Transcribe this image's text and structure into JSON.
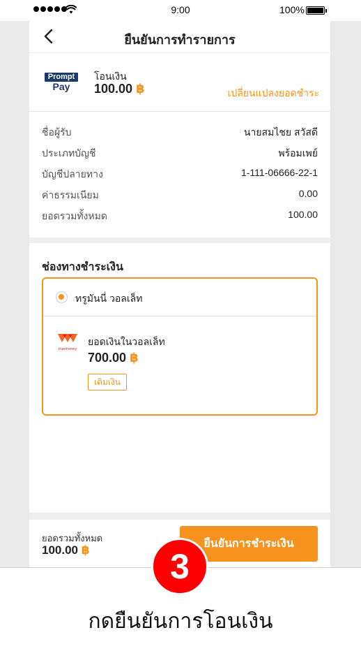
{
  "status_bar": {
    "time": "9:00",
    "battery": "100%"
  },
  "nav": {
    "title": "ยืนยันการทำรายการ"
  },
  "summary": {
    "logo": {
      "top": "Prompt",
      "bottom": "Pay"
    },
    "type": "โอนเงิน",
    "amount": "100.00",
    "currency": "฿",
    "change_link": "เปลี่ยนแปลงยอดชำระ"
  },
  "details": [
    {
      "label": "ชื่อผู้รับ",
      "value": "นายสมไชย สวัสดี"
    },
    {
      "label": "ประเภทบัญชี",
      "value": "พร้อมเพย์"
    },
    {
      "label": "บัญชีปลายทาง",
      "value": "1-111-06666-22-1"
    },
    {
      "label": "ค่าธรรมเนียม",
      "value": "0.00"
    },
    {
      "label": "ยอดรวมทั้งหมด",
      "value": "100.00"
    }
  ],
  "payment": {
    "title": "ช่องทางชำระเงิน",
    "wallet_name": "ทรูมันนี่ วอลเล็ท",
    "logo_text": "truemoney",
    "balance_label": "ยอดเงินในวอลเล็ท",
    "balance": "700.00",
    "currency": "฿",
    "topup_label": "เติมเงิน"
  },
  "footer": {
    "total_label": "ยอดรวมทั้งหมด",
    "total": "100.00",
    "currency": "฿",
    "confirm_label": "ยืนยันการชำระเงิน"
  },
  "step": {
    "number": "3",
    "caption": "กดยืนยันการโอนเงิน"
  },
  "colors": {
    "accent": "#f5931e",
    "step_badge": "#ff0000",
    "promptpay_blue": "#1a3a6e"
  },
  "icons": {
    "back": "chevron-left-icon",
    "wifi": "wifi-icon",
    "battery": "battery-icon",
    "radio": "radio-selected-icon"
  }
}
